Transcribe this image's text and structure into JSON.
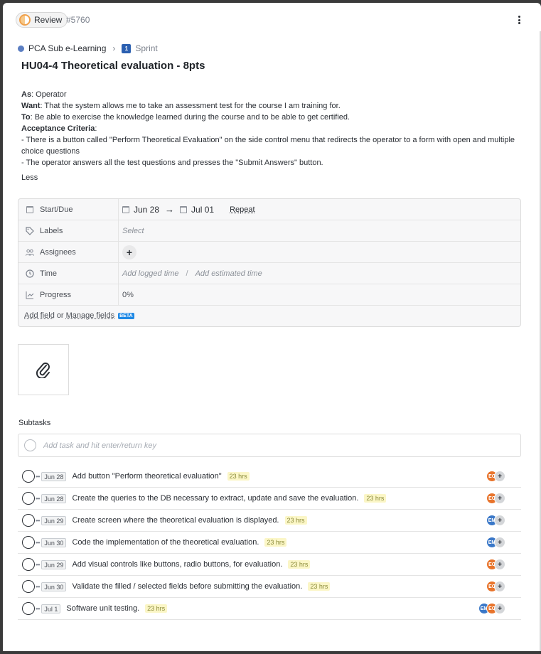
{
  "header": {
    "status_label": "Review",
    "task_id": "#5760"
  },
  "breadcrumb": {
    "list_name": "PCA Sub e-Learning",
    "sprint_badge": "1",
    "sprint_label": "Sprint"
  },
  "title": "HU04-4 Theoretical evaluation - 8pts",
  "description": {
    "as_label": "As",
    "as_text": ": Operator",
    "want_label": "Want",
    "want_text": ": That the system allows me to take an assessment test for the course I am training for.",
    "to_label": "To",
    "to_text": ": Be able to exercise the knowledge learned during the course and to be able to get certified.",
    "criteria_label": "Acceptance Criteria",
    "criteria_suffix": ":",
    "criteria_1": "- There is a button called \"Perform Theoretical Evaluation\" on the side control menu that redirects the operator to a form with open and multiple choice questions",
    "criteria_2": "- The operator answers all the test questions and presses the \"Submit Answers\" button.",
    "less_label": "Less"
  },
  "fields": {
    "start_due_label": "Start/Due",
    "start_date": "Jun 28",
    "arrow": "→",
    "due_date": "Jul 01",
    "repeat_label": "Repeat",
    "labels_label": "Labels",
    "labels_placeholder": "Select",
    "assignees_label": "Assignees",
    "assignees_add": "+",
    "time_label": "Time",
    "logged_placeholder": "Add logged time",
    "slash": "/",
    "estimated_placeholder": "Add estimated time",
    "progress_label": "Progress",
    "progress_value": "0%",
    "add_field_label": "Add field",
    "or_label": "or",
    "manage_fields_label": "Manage fields",
    "beta_badge": "BETA"
  },
  "subtasks": {
    "label": "Subtasks",
    "input_placeholder": "Add task and hit enter/return key",
    "items": [
      {
        "date": "Jun 28",
        "text": "Add button \"Perform theoretical evaluation\"",
        "hrs": "23 hrs",
        "avatars": [
          {
            "initials": "EC",
            "color": "orange"
          }
        ]
      },
      {
        "date": "Jun 28",
        "text": "Create the queries to the DB necessary to extract, update and save the evaluation.",
        "hrs": "23 hrs",
        "avatars": [
          {
            "initials": "EC",
            "color": "orange"
          }
        ]
      },
      {
        "date": "Jun 29",
        "text": "Create screen where the theoretical evaluation is displayed.",
        "hrs": "23 hrs",
        "avatars": [
          {
            "initials": "EM",
            "color": "blue"
          }
        ]
      },
      {
        "date": "Jun 30",
        "text": "Code the implementation of the theoretical evaluation.",
        "hrs": "23 hrs",
        "avatars": [
          {
            "initials": "EM",
            "color": "blue"
          }
        ]
      },
      {
        "date": "Jun 29",
        "text": "Add visual controls like buttons, radio buttons, for evaluation.",
        "hrs": "23 hrs",
        "avatars": [
          {
            "initials": "EC",
            "color": "orange"
          }
        ]
      },
      {
        "date": "Jun 30",
        "text": "Validate the filled / selected fields before submitting the evaluation.",
        "hrs": "23 hrs",
        "avatars": [
          {
            "initials": "EC",
            "color": "orange"
          }
        ]
      },
      {
        "date": "Jul 1",
        "text": "Software unit testing.",
        "hrs": "23 hrs",
        "avatars": [
          {
            "initials": "EM",
            "color": "blue"
          },
          {
            "initials": "EC",
            "color": "orange"
          }
        ]
      }
    ]
  },
  "colors": {
    "status_accent": "#f0a04b",
    "beta_badge": "#1e88e5",
    "avatar_orange": "#e8742c",
    "avatar_blue": "#3b78c8"
  },
  "icons": [
    "more-vertical-icon",
    "calendar-icon",
    "tag-icon",
    "users-icon",
    "clock-icon",
    "progress-chart-icon",
    "paperclip-icon",
    "chevron-right-icon"
  ]
}
